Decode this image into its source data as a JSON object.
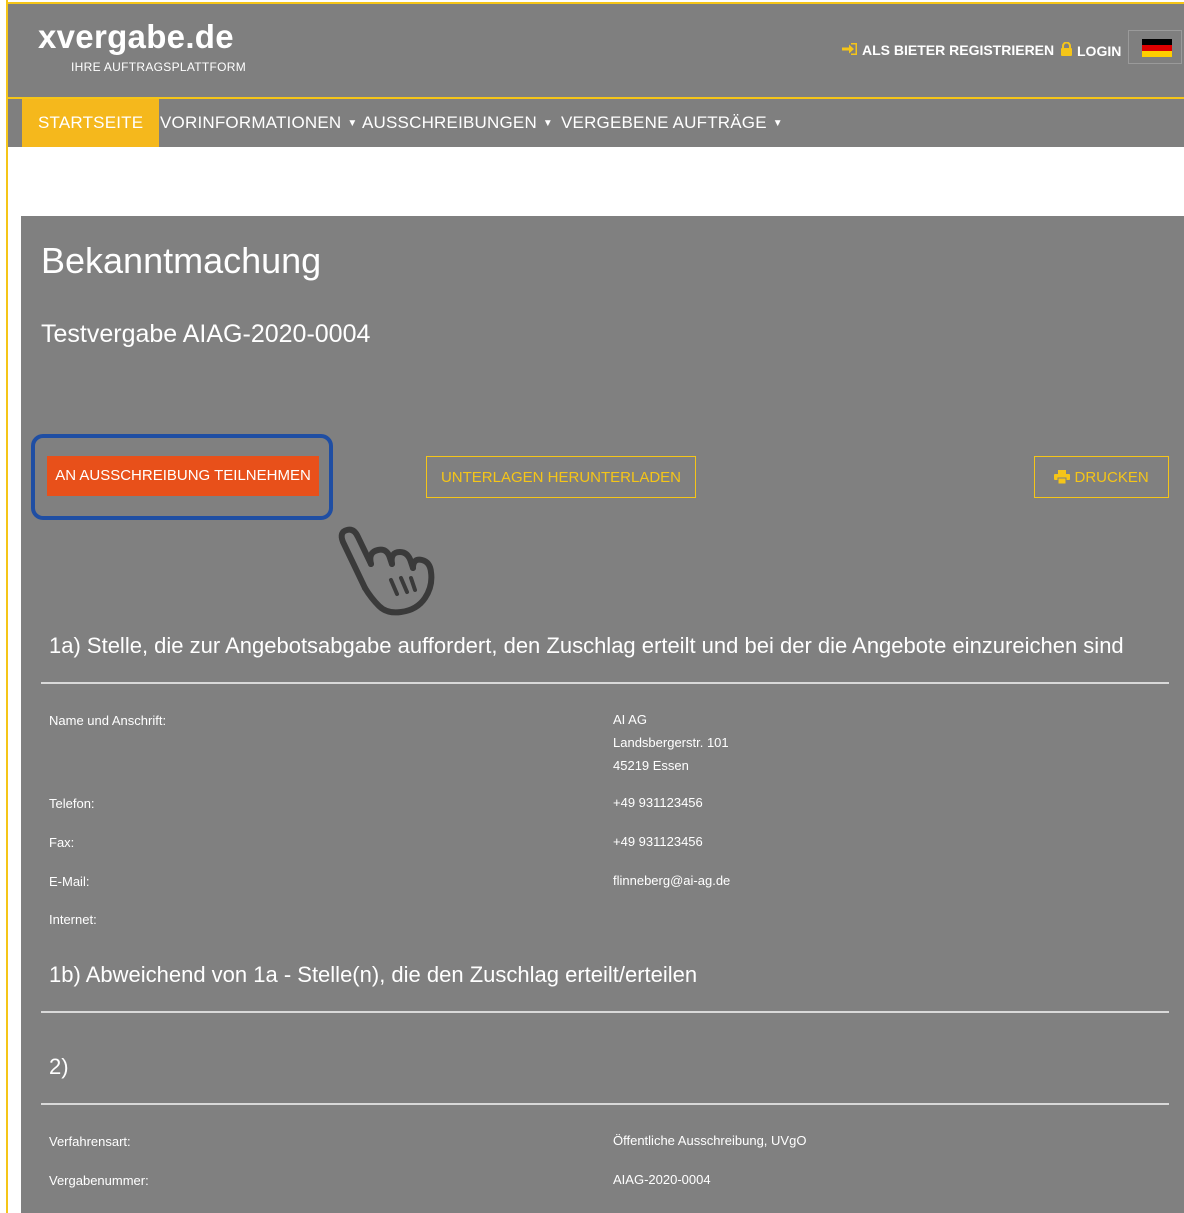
{
  "header": {
    "logo": "xvergabe.de",
    "tagline": "IHRE AUFTRAGSPLATTFORM",
    "register_label": "ALS BIETER REGISTRIEREN",
    "register_icon": "sign-in-icon",
    "login_label": "LOGIN",
    "login_icon": "lock-icon",
    "language_flag": "germany-flag"
  },
  "nav": {
    "items": [
      {
        "label": "STARTSEITE",
        "active": true
      },
      {
        "label": "VORINFORMATIONEN",
        "dropdown": true
      },
      {
        "label": "AUSSCHREIBUNGEN",
        "dropdown": true
      },
      {
        "label": "VERGEBENE AUFTRÄGE",
        "dropdown": true
      }
    ]
  },
  "page": {
    "title": "Bekanntmachung",
    "subtitle": "Testvergabe AIAG-2020-0004"
  },
  "actions": {
    "participate_label": "AN AUSSCHREIBUNG TEILNEHMEN",
    "download_label": "UNTERLAGEN HERUNTERLADEN",
    "print_label": "DRUCKEN",
    "print_icon": "printer-icon"
  },
  "section_1a": {
    "title": "1a) Stelle, die zur Angebotsabgabe auffordert, den Zuschlag erteilt und bei der die Angebote einzureichen sind",
    "rows": [
      {
        "label": "Name und Anschrift:",
        "value_lines": [
          "AI AG",
          "Landsbergerstr. 101",
          "45219 Essen"
        ]
      },
      {
        "label": "Telefon:",
        "value": "+49 931123456"
      },
      {
        "label": "Fax:",
        "value": "+49 931123456"
      },
      {
        "label": "E-Mail:",
        "value": "flinneberg@ai-ag.de"
      },
      {
        "label": "Internet:",
        "value": ""
      }
    ]
  },
  "section_1b": {
    "title": "1b) Abweichend von 1a - Stelle(n), die den Zuschlag erteilt/erteilen"
  },
  "section_2": {
    "title": "2)",
    "rows": [
      {
        "label": "Verfahrensart:",
        "value": "Öffentliche Ausschreibung, UVgO"
      },
      {
        "label": "Vergabenummer:",
        "value": "AIAG-2020-0004"
      }
    ]
  },
  "colors": {
    "accent": "#f5c518",
    "primary_button": "#e8501a",
    "panel": "#808080",
    "highlight": "#1f4ea3"
  }
}
